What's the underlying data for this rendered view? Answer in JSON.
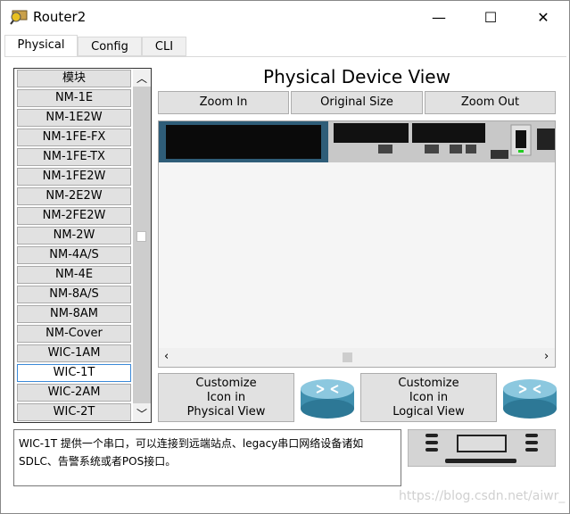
{
  "window": {
    "title": "Router2",
    "minimize": "—",
    "maximize": "☐",
    "close": "✕"
  },
  "tabs": [
    {
      "label": "Physical",
      "active": true
    },
    {
      "label": "Config"
    },
    {
      "label": "CLI"
    }
  ],
  "modules": {
    "header": "模块",
    "items": [
      "NM-1E",
      "NM-1E2W",
      "NM-1FE-FX",
      "NM-1FE-TX",
      "NM-1FE2W",
      "NM-2E2W",
      "NM-2FE2W",
      "NM-2W",
      "NM-4A/S",
      "NM-4E",
      "NM-8A/S",
      "NM-8AM",
      "NM-Cover",
      "WIC-1AM",
      "WIC-1T",
      "WIC-2AM",
      "WIC-2T"
    ],
    "selected": "WIC-1T"
  },
  "main": {
    "title": "Physical Device View",
    "zoom_in": "Zoom In",
    "original_size": "Original Size",
    "zoom_out": "Zoom Out",
    "customize_physical": [
      "Customize",
      "Icon in",
      "Physical View"
    ],
    "customize_logical": [
      "Customize",
      "Icon in",
      "Logical View"
    ]
  },
  "description": "WIC-1T 提供一个串口，可以连接到远端站点、legacy串口网络设备诸如SDLC、告警系统或者POS接口。",
  "watermark": "https://blog.csdn.net/aiwr_"
}
